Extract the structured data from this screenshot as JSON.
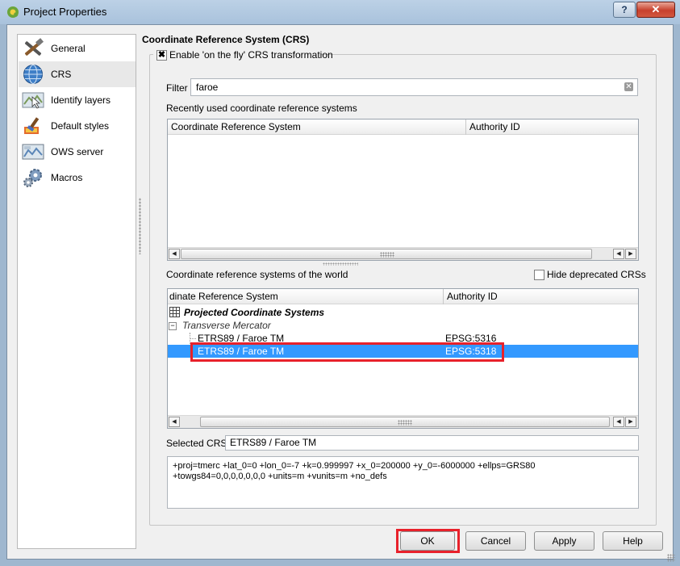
{
  "window": {
    "title": "Project Properties",
    "help_label": "?",
    "close_label": "✕"
  },
  "sidebar": {
    "items": [
      {
        "label": "General",
        "icon": "tools-icon",
        "selected": false
      },
      {
        "label": "CRS",
        "icon": "globe-icon",
        "selected": true
      },
      {
        "label": "Identify layers",
        "icon": "identify-map-icon",
        "selected": false
      },
      {
        "label": "Default styles",
        "icon": "paintbrush-icon",
        "selected": false
      },
      {
        "label": "OWS server",
        "icon": "ows-map-icon",
        "selected": false
      },
      {
        "label": "Macros",
        "icon": "gears-icon",
        "selected": false
      }
    ]
  },
  "crs": {
    "section_title": "Coordinate Reference System (CRS)",
    "otf_checkbox_label": "Enable 'on the fly' CRS transformation",
    "otf_checked": true,
    "filter_label": "Filter",
    "filter_value": "faroe",
    "recent_label": "Recently used coordinate reference systems",
    "recent_columns": [
      "Coordinate Reference System",
      "Authority ID"
    ],
    "world_label": "Coordinate reference systems of the world",
    "hide_deprecated_label": "Hide deprecated CRSs",
    "hide_deprecated_checked": false,
    "world_columns": [
      "dinate Reference System",
      "Authority ID"
    ],
    "tree": {
      "group": "Projected Coordinate Systems",
      "subgroup": "Transverse Mercator",
      "rows": [
        {
          "name": "ETRS89 / Faroe TM",
          "id": "EPSG:5316",
          "selected": false
        },
        {
          "name": "ETRS89 / Faroe TM",
          "id": "EPSG:5318",
          "selected": true
        }
      ]
    },
    "selected_label": "Selected CRS:",
    "selected_value": "ETRS89 / Faroe TM",
    "proj_string": "+proj=tmerc +lat_0=0 +lon_0=-7 +k=0.999997 +x_0=200000 +y_0=-6000000 +ellps=GRS80\n+towgs84=0,0,0,0,0,0,0 +units=m +vunits=m +no_defs"
  },
  "buttons": {
    "ok": "OK",
    "cancel": "Cancel",
    "apply": "Apply",
    "help": "Help"
  },
  "colors": {
    "selection": "#3399ff",
    "highlight": "#e8212b"
  }
}
